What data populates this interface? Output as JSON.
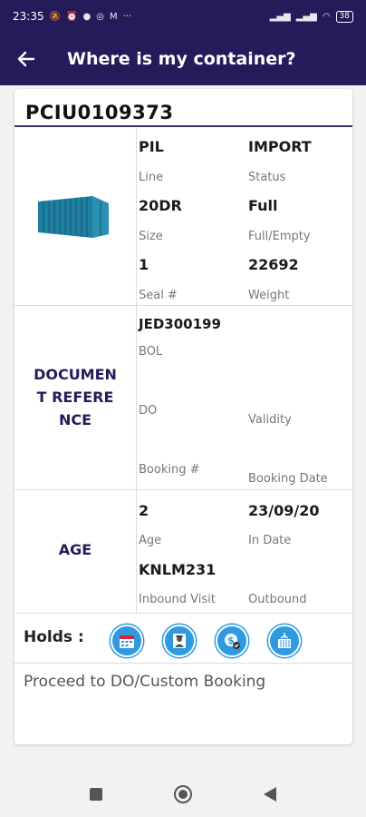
{
  "status_bar": {
    "time": "23:35",
    "battery": "38"
  },
  "header": {
    "title": "Where is my container?"
  },
  "container": {
    "number": "PCIU0109373",
    "line": {
      "value": "PIL",
      "label": "Line"
    },
    "status": {
      "value": "IMPORT",
      "label": "Status"
    },
    "size": {
      "value": "20DR",
      "label": "Size"
    },
    "full_empty": {
      "value": "Full",
      "label": "Full/Empty"
    },
    "seal": {
      "value": "1",
      "label": "Seal #"
    },
    "weight": {
      "value": "22692",
      "label": "Weight"
    }
  },
  "document_reference": {
    "title_lines": [
      "DOCUMEN",
      "T REFERE",
      "NCE"
    ],
    "bol": {
      "value": "JED300199",
      "label": "BOL"
    },
    "do": {
      "value": "",
      "label": "DO"
    },
    "validity": {
      "value": "",
      "label": "Validity"
    },
    "booking_no": {
      "value": "",
      "label": "Booking #"
    },
    "booking_date": {
      "value": "",
      "label": "Booking Date"
    }
  },
  "age": {
    "title": "AGE",
    "age": {
      "value": "2",
      "label": "Age"
    },
    "in_date": {
      "value": "23/09/20",
      "label": "In Date"
    },
    "inbound_visit": {
      "value": "KNLM231",
      "label": "Inbound Visit"
    },
    "outbound": {
      "value": "",
      "label": "Outbound"
    }
  },
  "holds": {
    "label": "Holds :",
    "icons": [
      "calendar-hold-icon",
      "officer-hold-icon",
      "payment-hold-icon",
      "container-hold-icon"
    ]
  },
  "action": {
    "text": "Proceed to DO/Custom Booking"
  },
  "colors": {
    "primary": "#241c5a",
    "accent": "#2f9ae0",
    "container": "#1f7fa0"
  }
}
